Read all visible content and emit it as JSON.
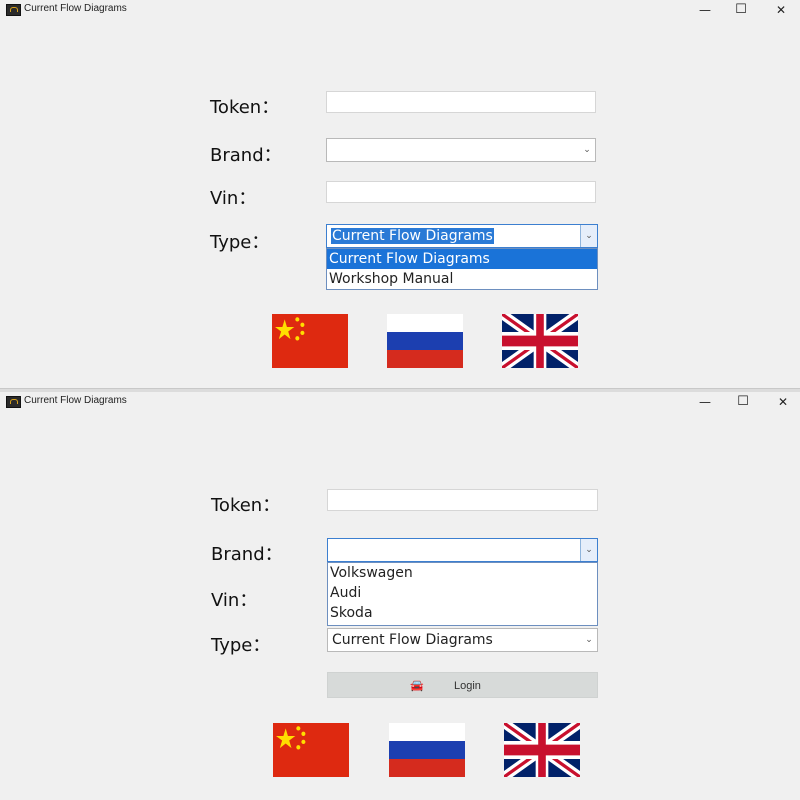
{
  "windows": [
    {
      "title": "Current Flow Diagrams",
      "controls": {
        "minimize": "—",
        "maximize": "☐",
        "close": "✕"
      },
      "labels": {
        "token": "Token：",
        "brand": "Brand：",
        "vin": "Vin：",
        "type": "Type："
      },
      "fields": {
        "token": "",
        "brand": "",
        "vin": "",
        "type": "Current Flow Diagrams"
      },
      "type_dropdown": {
        "open": true,
        "options": [
          "Current Flow Diagrams",
          "Workshop Manual"
        ],
        "highlighted": "Current Flow Diagrams"
      },
      "flags": [
        "china",
        "russia",
        "united-kingdom"
      ]
    },
    {
      "title": "Current Flow Diagrams",
      "controls": {
        "minimize": "—",
        "maximize": "☐",
        "close": "✕"
      },
      "labels": {
        "token": "Token：",
        "brand": "Brand：",
        "vin": "Vin：",
        "type": "Type："
      },
      "fields": {
        "token": "",
        "brand": "",
        "vin": "",
        "type": "Current Flow Diagrams"
      },
      "brand_dropdown": {
        "open": true,
        "options": [
          "Volkswagen",
          "Audi",
          "Skoda"
        ]
      },
      "login": {
        "label": "Login",
        "icon": "car-icon"
      },
      "flags": [
        "china",
        "russia",
        "united-kingdom"
      ]
    }
  ],
  "colors": {
    "window_bg": "#f0f0f0",
    "selection": "#1a73d8",
    "cn_red": "#de2910",
    "cn_yellow": "#ffde00",
    "ru_blue": "#1c3fb0",
    "ru_red": "#d52b1e",
    "uk_blue": "#012169",
    "uk_red": "#c8102e"
  }
}
